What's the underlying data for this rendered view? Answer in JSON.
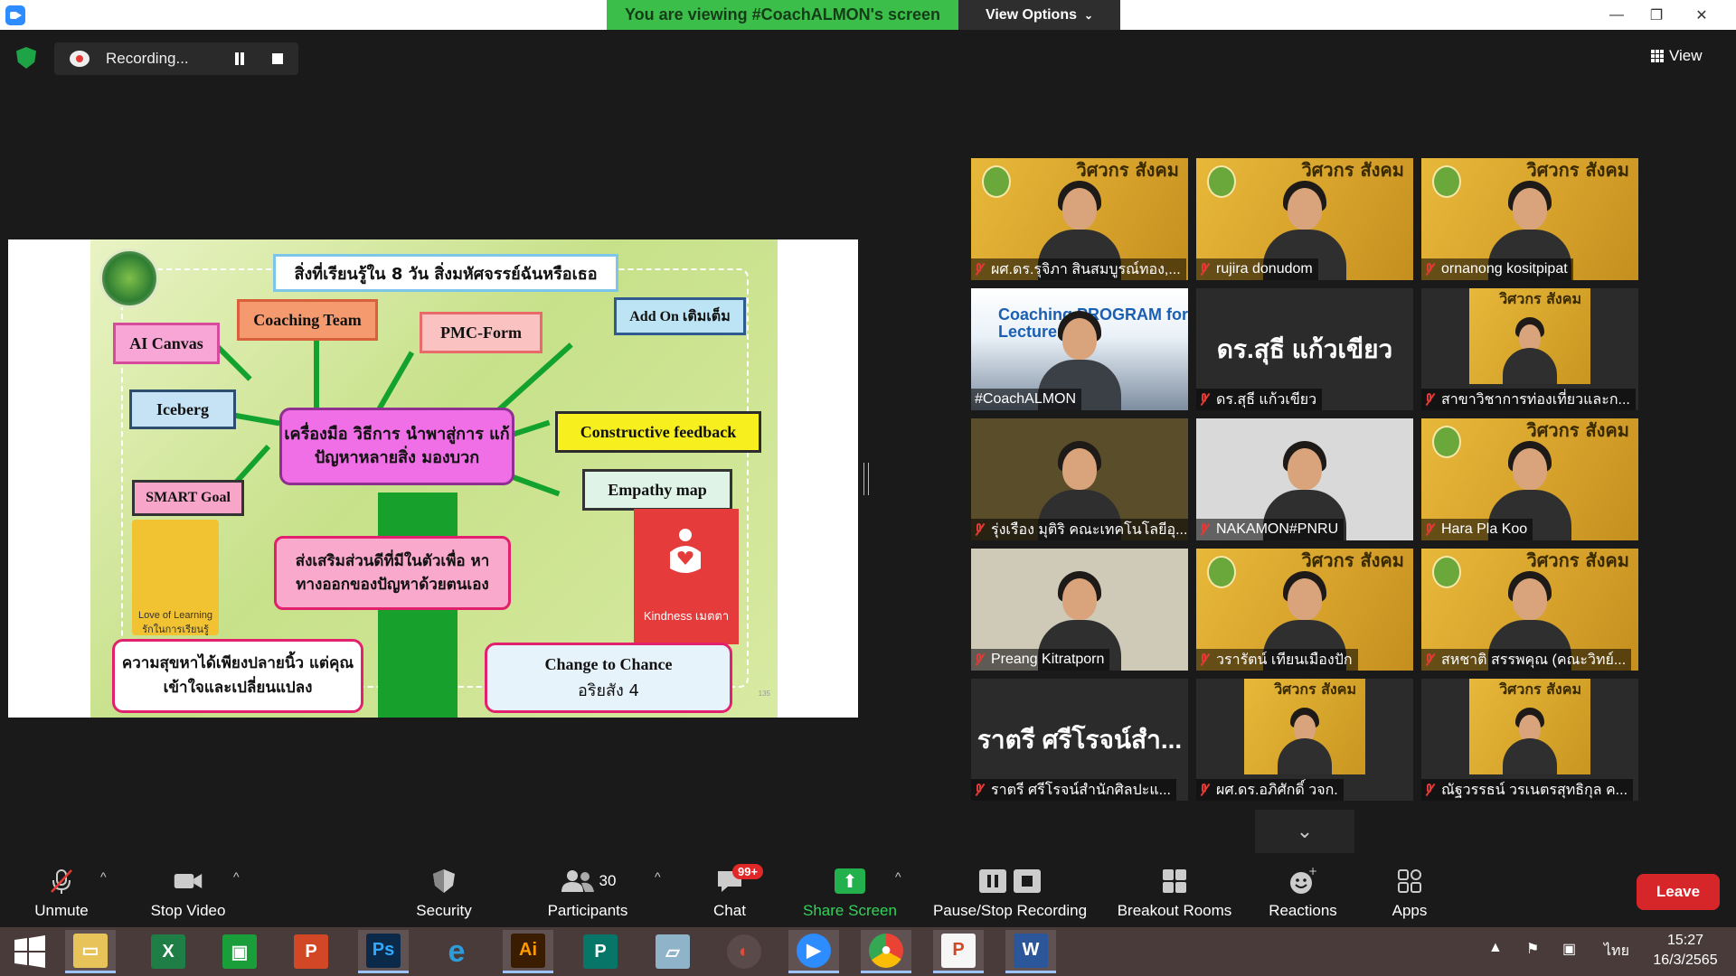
{
  "titlebar": {
    "viewing_banner": "You are viewing #CoachALMON's screen",
    "view_options": "View Options"
  },
  "recording": {
    "status": "Recording..."
  },
  "view_button": "View",
  "slide": {
    "header": "สิ่งที่เรียนรู้ใน 8 วัน สิ่งมหัศจรรย์ฉันหรือเธอ",
    "center": "เครื่องมือ วิธีการ นำพาสู่การ แก้ปัญหาหลายสิ่ง มองบวก",
    "boxes": {
      "ai_canvas": "AI Canvas",
      "coaching_team": "Coaching Team",
      "pmc_form": "PMC-Form",
      "add_on": "Add On เติมเต็ม",
      "iceberg": "Iceberg",
      "constructive": "Constructive feedback",
      "smart_goal": "SMART Goal",
      "empathy": "Empathy map",
      "strength": "ส่งเสริมส่วนดีที่มีในตัวเพื่อ หาทางออกของปัญหาด้วยตนเอง",
      "happiness": "ความสุขหาได้เพียงปลายนิ้ว แต่คุณเข้าใจและเปลี่ยนแปลง",
      "change": "Change to Chance",
      "change_sub": "อริยสัง 4"
    },
    "book_label": "Love of Learning รักในการเรียนรู้",
    "kind_label": "Kindness เมตตา",
    "page_num": "135"
  },
  "participants": [
    {
      "name": "ผศ.ดร.รุจิภา สินสมบูรณ์ทอง,...",
      "kind": "banner"
    },
    {
      "name": "rujira donudom",
      "kind": "banner"
    },
    {
      "name": "ornanong kositpipat",
      "kind": "banner"
    },
    {
      "name": "#CoachALMON",
      "kind": "coach",
      "headline": "Coaching PROGRAM for Lecturer"
    },
    {
      "name": "ดร.สุธี แก้วเขียว",
      "kind": "text",
      "big": "ดร.สุธี แก้วเขียว"
    },
    {
      "name": "สาขาวิชาการท่องเที่ยวและก...",
      "kind": "inset"
    },
    {
      "name": "รุ่งเรือง มุติริ คณะเทคโนโลยีอุ...",
      "kind": "person"
    },
    {
      "name": "NAKAMON#PNRU",
      "kind": "person"
    },
    {
      "name": "Hara Pla Koo",
      "kind": "banner"
    },
    {
      "name": "Preang Kitratporn",
      "kind": "person"
    },
    {
      "name": "วรารัตน์ เทียนเมืองปัก",
      "kind": "banner"
    },
    {
      "name": "สหชาติ สรรพคุณ (คณะวิทย์...",
      "kind": "banner"
    },
    {
      "name": "ราตรี ศรีโรจน์สำนักศิลปะแ...",
      "kind": "text",
      "big": "ราตรี ศรีโรจน์สำ..."
    },
    {
      "name": "ผศ.ดร.อภิศักดิ์ วจก.",
      "kind": "inset"
    },
    {
      "name": "ณัฐวรรธน์ วรเนตรสุทธิกุล ค...",
      "kind": "inset"
    }
  ],
  "banner_text": "วิศวกร สังคม",
  "toolbar": {
    "unmute": "Unmute",
    "stop_video": "Stop Video",
    "security": "Security",
    "participants": "Participants",
    "participants_count": "30",
    "chat": "Chat",
    "chat_badge": "99+",
    "share_screen": "Share Screen",
    "pause_recording": "Pause/Stop Recording",
    "breakout": "Breakout Rooms",
    "reactions": "Reactions",
    "apps": "Apps",
    "leave": "Leave"
  },
  "taskbar": {
    "language": "ไทย",
    "time": "15:27",
    "date": "16/3/2565"
  },
  "colors": {
    "banner_green": "#3bbf4a",
    "leave_red": "#d7262a",
    "share_green": "#22b14c",
    "active_outline": "#f3dc5a"
  }
}
